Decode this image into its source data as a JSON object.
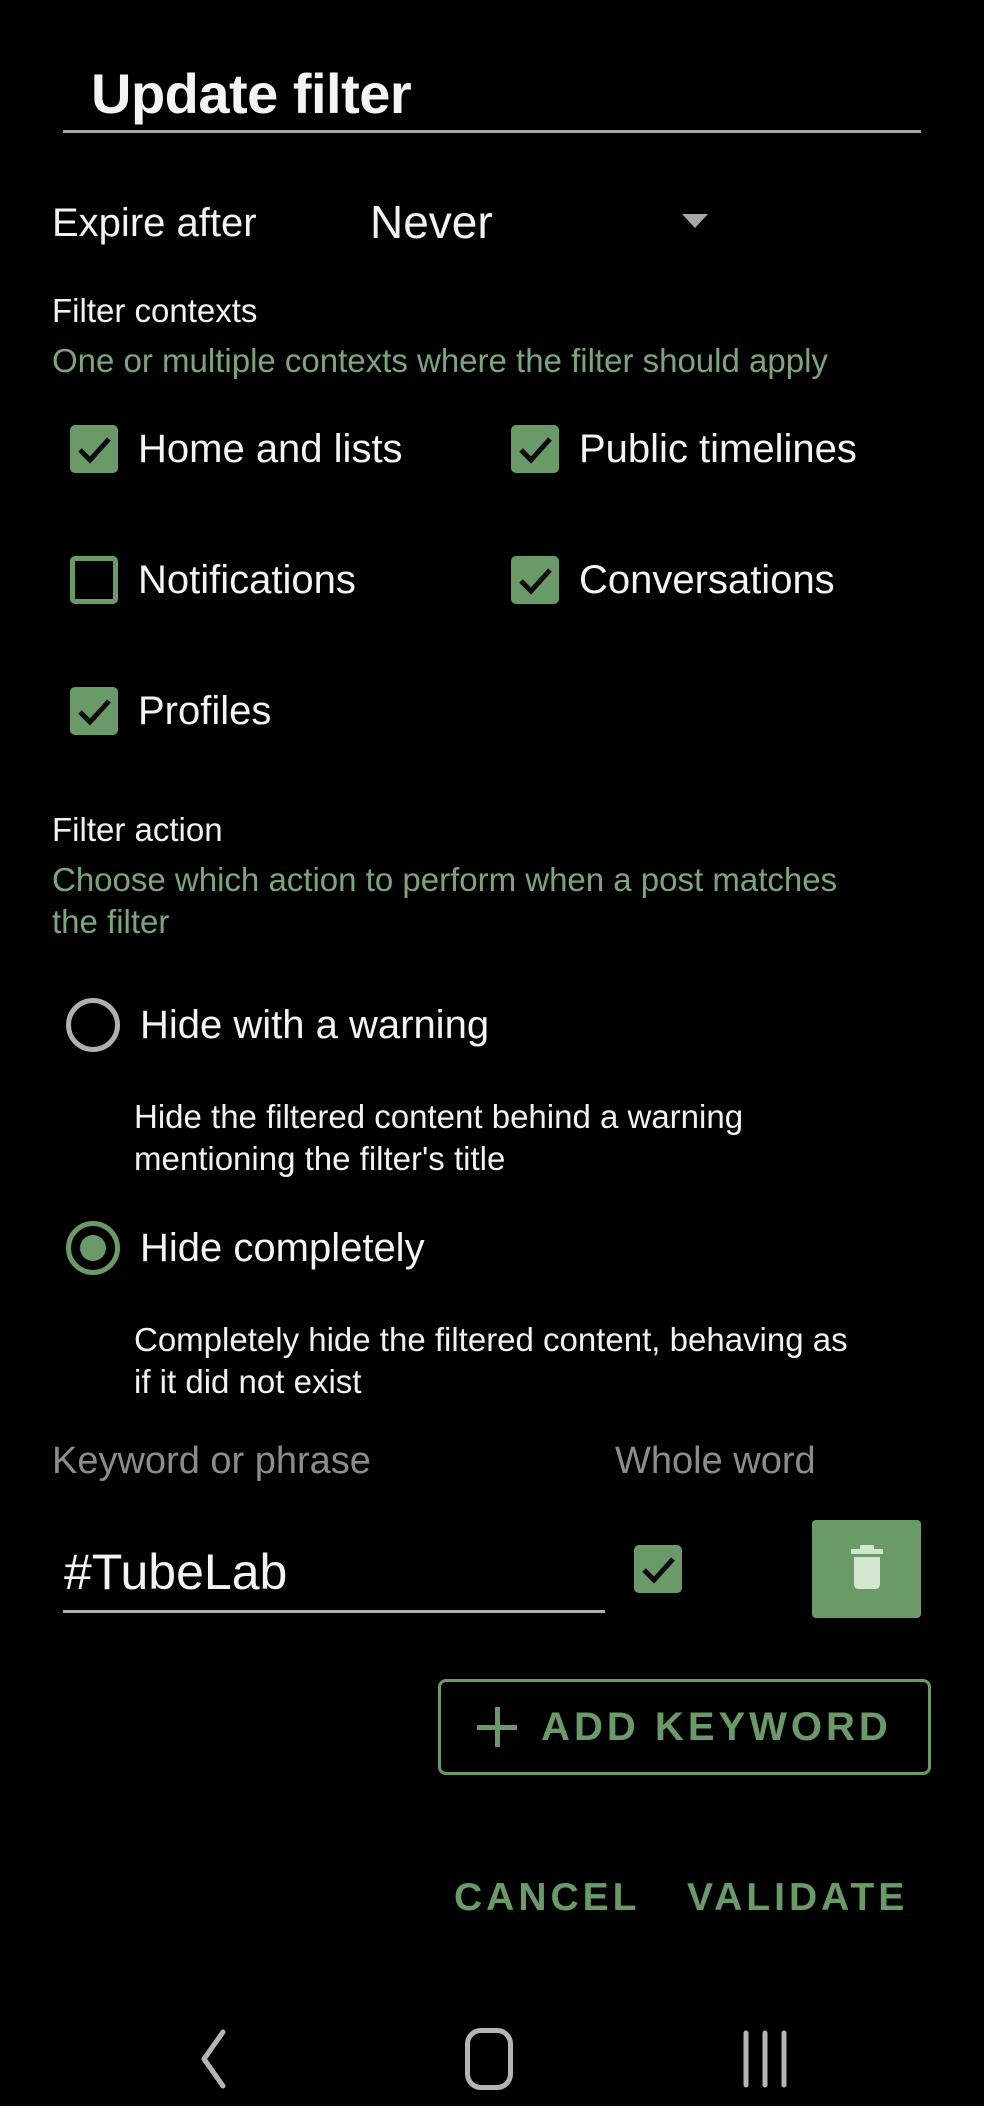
{
  "dialog": {
    "title": "Update filter"
  },
  "expire": {
    "label": "Expire after",
    "selected": "Never"
  },
  "contexts": {
    "label": "Filter contexts",
    "subtitle": "One or multiple contexts where the filter should apply",
    "items": [
      {
        "label": "Home and lists",
        "checked": true
      },
      {
        "label": "Public timelines",
        "checked": true
      },
      {
        "label": "Notifications",
        "checked": false
      },
      {
        "label": "Conversations",
        "checked": true
      },
      {
        "label": "Profiles",
        "checked": true
      }
    ]
  },
  "action": {
    "label": "Filter action",
    "subtitle_line1": "Choose which action to perform when a post matches",
    "subtitle_line2": "the filter",
    "options": [
      {
        "label": "Hide with a warning",
        "selected": false,
        "desc_line1": "Hide the filtered content behind a warning",
        "desc_line2": "mentioning the filter's title"
      },
      {
        "label": "Hide completely",
        "selected": true,
        "desc_line1": "Completely hide the filtered content, behaving as",
        "desc_line2": "if it did not exist"
      }
    ]
  },
  "keywords": {
    "header_keyword": "Keyword or phrase",
    "header_whole_word": "Whole word",
    "rows": [
      {
        "value": "#TubeLab",
        "whole_word": true
      }
    ],
    "add_label": "ADD KEYWORD"
  },
  "buttons": {
    "cancel": "CANCEL",
    "validate": "VALIDATE"
  },
  "colors": {
    "accent": "#6b9a69",
    "subtitle": "#7da57b",
    "background": "#000000"
  }
}
